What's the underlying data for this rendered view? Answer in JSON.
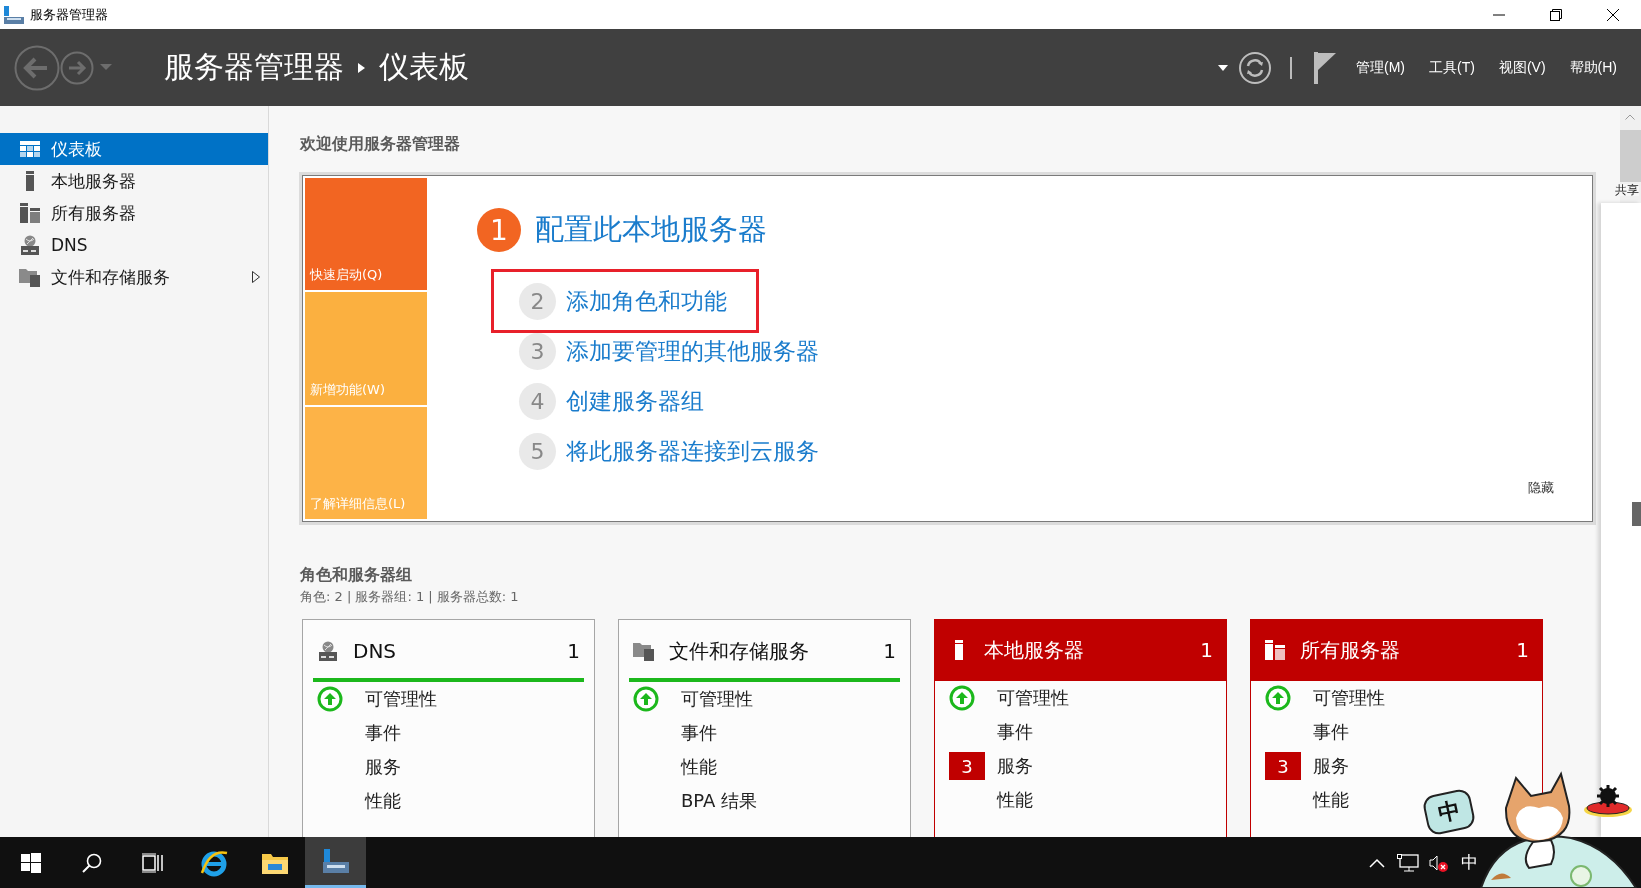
{
  "window": {
    "title": "服务器管理器"
  },
  "header": {
    "breadcrumb": [
      "服务器管理器",
      "仪表板"
    ],
    "menus": [
      "管理(M)",
      "工具(T)",
      "视图(V)",
      "帮助(H)"
    ]
  },
  "sidebar": {
    "items": [
      {
        "label": "仪表板",
        "kind": "dashboard",
        "selected": true,
        "expandable": false
      },
      {
        "label": "本地服务器",
        "kind": "server",
        "selected": false,
        "expandable": false
      },
      {
        "label": "所有服务器",
        "kind": "servers",
        "selected": false,
        "expandable": false
      },
      {
        "label": "DNS",
        "kind": "dns",
        "selected": false,
        "expandable": false
      },
      {
        "label": "文件和存储服务",
        "kind": "files",
        "selected": false,
        "expandable": true
      }
    ]
  },
  "welcome": {
    "title": "欢迎使用服务器管理器",
    "tiles": [
      {
        "label": "快速启动(Q)",
        "selected": true
      },
      {
        "label": "新增功能(W)",
        "selected": false
      },
      {
        "label": "了解详细信息(L)",
        "selected": false
      }
    ],
    "steps": [
      {
        "number": "1",
        "label": "配置此本地服务器",
        "kind": "primary",
        "highlighted": false
      },
      {
        "number": "2",
        "label": "添加角色和功能",
        "kind": "secondary",
        "highlighted": true
      },
      {
        "number": "3",
        "label": "添加要管理的其他服务器",
        "kind": "secondary",
        "highlighted": false
      },
      {
        "number": "4",
        "label": "创建服务器组",
        "kind": "secondary",
        "highlighted": false
      },
      {
        "number": "5",
        "label": "将此服务器连接到云服务",
        "kind": "secondary",
        "highlighted": false
      }
    ],
    "hide_link": "隐藏"
  },
  "roles": {
    "title": "角色和服务器组",
    "summary": "角色: 2 | 服务器组: 1 | 服务器总数: 1",
    "cards": [
      {
        "title": "DNS",
        "count": "1",
        "kind": "dns",
        "alert": false,
        "rows": [
          {
            "label": "可管理性",
            "ok": true
          },
          {
            "label": "事件",
            "ok": false
          },
          {
            "label": "服务",
            "ok": false
          },
          {
            "label": "性能",
            "ok": false
          }
        ]
      },
      {
        "title": "文件和存储服务",
        "count": "1",
        "kind": "files",
        "alert": false,
        "rows": [
          {
            "label": "可管理性",
            "ok": true
          },
          {
            "label": "事件",
            "ok": false
          },
          {
            "label": "性能",
            "ok": false
          },
          {
            "label": "BPA 结果",
            "ok": false
          }
        ]
      },
      {
        "title": "本地服务器",
        "count": "1",
        "kind": "server",
        "alert": true,
        "rows": [
          {
            "label": "可管理性",
            "ok": true
          },
          {
            "label": "事件",
            "ok": false
          },
          {
            "label": "服务",
            "ok": false,
            "badge": "3"
          },
          {
            "label": "性能",
            "ok": false
          }
        ]
      },
      {
        "title": "所有服务器",
        "count": "1",
        "kind": "servers",
        "alert": true,
        "rows": [
          {
            "label": "可管理性",
            "ok": true
          },
          {
            "label": "事件",
            "ok": false
          },
          {
            "label": "服务",
            "ok": false,
            "badge": "3"
          },
          {
            "label": "性能",
            "ok": false
          }
        ]
      }
    ]
  },
  "side_pane": {
    "label": "共享"
  },
  "taskbar": {
    "apps": [
      {
        "kind": "start",
        "selected": false
      },
      {
        "kind": "search",
        "selected": false
      },
      {
        "kind": "taskview",
        "selected": false
      },
      {
        "kind": "browser",
        "selected": false
      },
      {
        "kind": "folder",
        "selected": false
      },
      {
        "kind": "servermanager",
        "selected": true
      }
    ],
    "tray": [
      {
        "kind": "chevron"
      },
      {
        "kind": "network"
      },
      {
        "kind": "volume"
      },
      {
        "kind": "ime",
        "label": "中"
      }
    ]
  },
  "overlay": {
    "bubble": "中"
  }
}
